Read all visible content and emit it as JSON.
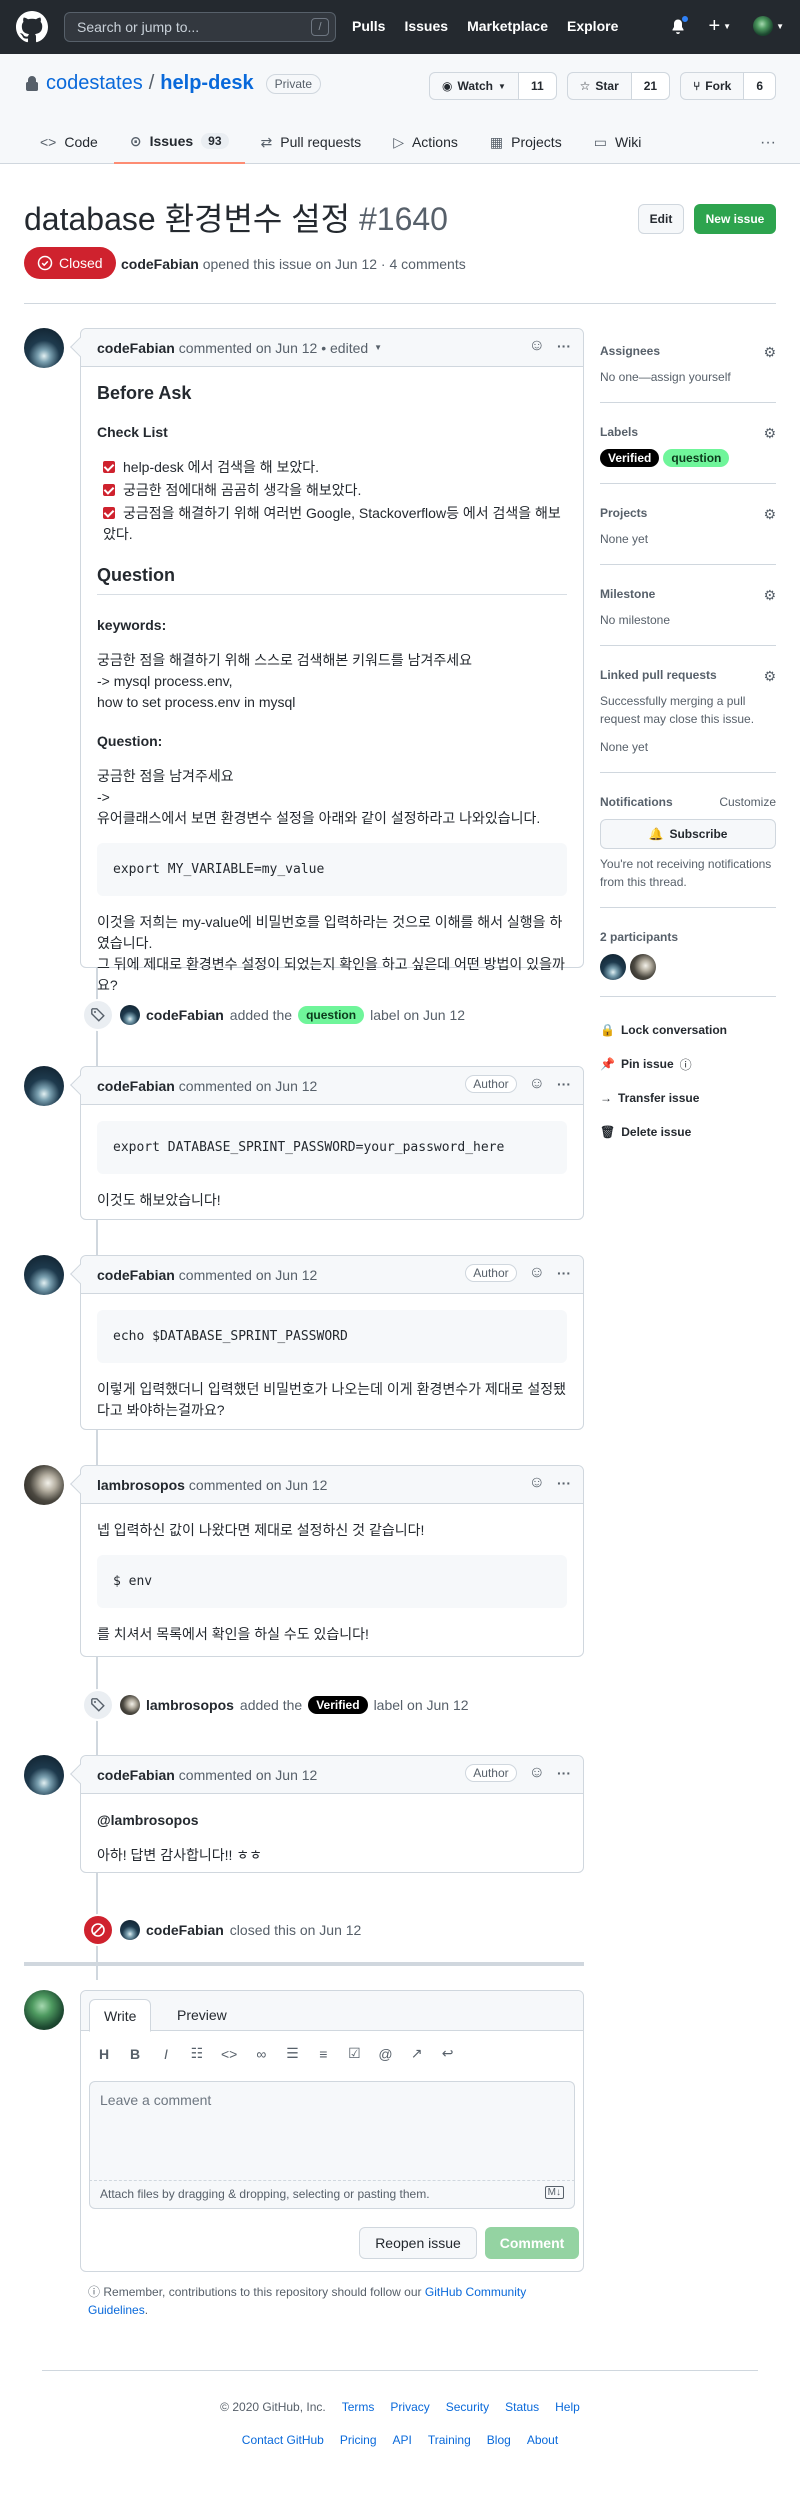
{
  "header": {
    "search_placeholder": "Search or jump to...",
    "search_key": "/",
    "nav": [
      "Pulls",
      "Issues",
      "Marketplace",
      "Explore"
    ]
  },
  "repo": {
    "owner": "codestates",
    "separator": "/",
    "name": "help-desk",
    "visibility": "Private",
    "actions": [
      {
        "label": "Watch",
        "count": "11"
      },
      {
        "label": "Star",
        "count": "21"
      },
      {
        "label": "Fork",
        "count": "6"
      }
    ],
    "tabs": [
      {
        "label": "Code"
      },
      {
        "label": "Issues",
        "count": "93"
      },
      {
        "label": "Pull requests"
      },
      {
        "label": "Actions"
      },
      {
        "label": "Projects"
      },
      {
        "label": "Wiki"
      }
    ]
  },
  "issue": {
    "title": "database 환경변수 설정",
    "number": "#1640",
    "state": "Closed",
    "author": "codeFabian",
    "meta": "opened this issue on Jun 12 · 4 comments",
    "edit_label": "Edit",
    "new_label": "New issue"
  },
  "comments": [
    {
      "author": "codeFabian",
      "meta": "commented on Jun 12 • edited",
      "h_before": "Before Ask",
      "h_check": "Check List",
      "checks": [
        "help-desk 에서 검색을 해 보았다.",
        "궁금한 점에대해 곰곰히 생각을 해보았다.",
        "궁금점을 해결하기 위해 여러번 Google, Stackoverflow등 에서 검색을 해보았다."
      ],
      "h_question": "Question",
      "kw_label": "keywords:",
      "kw_lines": [
        "궁금한 점을 해결하기 위해 스스로 검색해본 키워드를 남겨주세요",
        "-> mysql process.env,",
        "how to set process.env in mysql"
      ],
      "q_label": "Question:",
      "q_lines": [
        "궁금한 점을 남겨주세요",
        "->",
        "유어클래스에서 보면 환경변수 설정을 아래와 같이 설정하라고 나와있습니다."
      ],
      "code": "export MY_VARIABLE=my_value",
      "after": "이것을 저희는 my-value에 비밀번호를 입력하라는 것으로 이해를 해서 실행을 하였습니다.",
      "after2": "그 뒤에 제대로 환경변수 설정이 되었는지 확인을 하고 싶은데 어떤 방법이 있을까요?"
    },
    {
      "author": "codeFabian",
      "meta": "commented on Jun 12",
      "tag": "Author",
      "code": "export DATABASE_SPRINT_PASSWORD=your_password_here",
      "text": "이것도 해보았습니다!"
    },
    {
      "author": "codeFabian",
      "meta": "commented on Jun 12",
      "tag": "Author",
      "code": "echo $DATABASE_SPRINT_PASSWORD",
      "text": "이렇게 입력했더니 입력했던 비밀번호가 나오는데 이게 환경변수가 제대로 설정됐다고 봐야하는걸까요?"
    },
    {
      "author": "lambrosopos",
      "meta": "commented on Jun 12",
      "text1": "넵 입력하신 값이 나왔다면 제대로 설정하신 것 같습니다!",
      "code": "$ env",
      "text2": "를 치셔서 목록에서 확인을 하실 수도 있습니다!"
    },
    {
      "author": "codeFabian",
      "meta": "commented on Jun 12",
      "tag": "Author",
      "mention": "@lambrosopos",
      "text": "아하! 답변 감사합니다!! ㅎㅎ"
    }
  ],
  "events": [
    {
      "actor": "codeFabian",
      "pre": "added the",
      "label": "question",
      "post": "label on Jun 12"
    },
    {
      "actor": "lambrosopos",
      "pre": "added the",
      "label": "Verified",
      "post": "label on Jun 12"
    },
    {
      "actor": "codeFabian",
      "pre": "closed this on Jun 12"
    }
  ],
  "sidebar": {
    "assignees": {
      "title": "Assignees",
      "value": "No one—assign yourself"
    },
    "labels": {
      "title": "Labels",
      "items": [
        "Verified",
        "question"
      ]
    },
    "projects": {
      "title": "Projects",
      "value": "None yet"
    },
    "milestone": {
      "title": "Milestone",
      "value": "No milestone"
    },
    "linked": {
      "title": "Linked pull requests",
      "value": "Successfully merging a pull request may close this issue.",
      "value2": "None yet"
    },
    "notifications": {
      "title": "Notifications",
      "customize": "Customize",
      "button": "Subscribe",
      "note": "You're not receiving notifications from this thread."
    },
    "participants": {
      "title": "2 participants"
    },
    "actions": [
      "Lock conversation",
      "Pin issue",
      "Transfer issue",
      "Delete issue"
    ]
  },
  "form": {
    "tabs": [
      "Write",
      "Preview"
    ],
    "placeholder": "Leave a comment",
    "attach": "Attach files by dragging & dropping, selecting or pasting them.",
    "reopen": "Reopen issue",
    "comment": "Comment",
    "guide_pre": "Remember, contributions to this repository should follow our",
    "guide_link": "GitHub Community Guidelines",
    "guide_post": "."
  },
  "footer": {
    "row1": [
      "© 2020 GitHub, Inc.",
      "Terms",
      "Privacy",
      "Security",
      "Status",
      "Help"
    ],
    "row2": [
      "Contact GitHub",
      "Pricing",
      "API",
      "Training",
      "Blog",
      "About"
    ]
  },
  "colors": {
    "closed": "#cf222e",
    "primary": "#2da44e",
    "link": "#0969da",
    "label_question": "#6ff59a",
    "label_verified": "#000000"
  }
}
